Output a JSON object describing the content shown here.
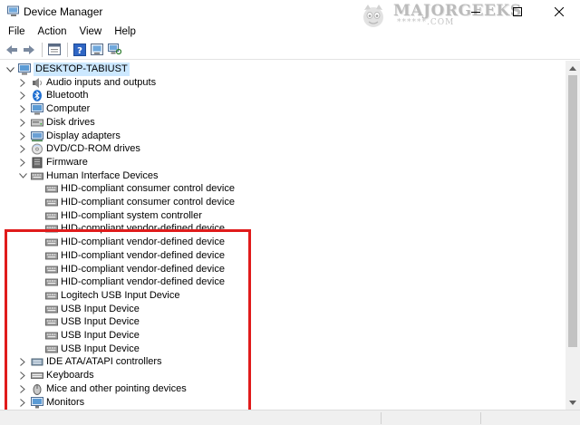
{
  "window": {
    "title": "Device Manager",
    "controls": [
      "minimize",
      "maximize",
      "close"
    ]
  },
  "watermark": {
    "brand": "MAJORGEEKS",
    "sub": "******.COM"
  },
  "menu": [
    {
      "label": "File"
    },
    {
      "label": "Action"
    },
    {
      "label": "View"
    },
    {
      "label": "Help"
    }
  ],
  "toolbar": [
    "back-arrow-icon",
    "forward-arrow-icon",
    "properties-icon",
    "help-icon",
    "scan-hardware-icon"
  ],
  "tree": {
    "root": "DESKTOP-TABIUST",
    "items": [
      {
        "label": "Audio inputs and outputs",
        "icon": "speaker-icon",
        "expanded": false
      },
      {
        "label": "Bluetooth",
        "icon": "bluetooth-icon",
        "expanded": false
      },
      {
        "label": "Computer",
        "icon": "computer-icon",
        "expanded": false
      },
      {
        "label": "Disk drives",
        "icon": "disk-drive-icon",
        "expanded": false
      },
      {
        "label": "Display adapters",
        "icon": "display-adapter-icon",
        "expanded": false
      },
      {
        "label": "DVD/CD-ROM drives",
        "icon": "dvd-drive-icon",
        "expanded": false
      },
      {
        "label": "Firmware",
        "icon": "firmware-icon",
        "expanded": false
      },
      {
        "label": "Human Interface Devices",
        "icon": "hid-icon",
        "expanded": true,
        "children": [
          "HID-compliant consumer control device",
          "HID-compliant consumer control device",
          "HID-compliant system controller",
          "HID-compliant vendor-defined device",
          "HID-compliant vendor-defined device",
          "HID-compliant vendor-defined device",
          "HID-compliant vendor-defined device",
          "HID-compliant vendor-defined device",
          "Logitech USB Input Device",
          "USB Input Device",
          "USB Input Device",
          "USB Input Device",
          "USB Input Device"
        ]
      },
      {
        "label": "IDE ATA/ATAPI controllers",
        "icon": "ide-controller-icon",
        "expanded": false
      },
      {
        "label": "Keyboards",
        "icon": "keyboard-icon",
        "expanded": false
      },
      {
        "label": "Mice and other pointing devices",
        "icon": "mouse-icon",
        "expanded": false
      },
      {
        "label": "Monitors",
        "icon": "monitor-icon",
        "expanded": false
      }
    ]
  },
  "colors": {
    "highlight_border": "#e01b1b",
    "root_selection": "#cce8ff"
  }
}
